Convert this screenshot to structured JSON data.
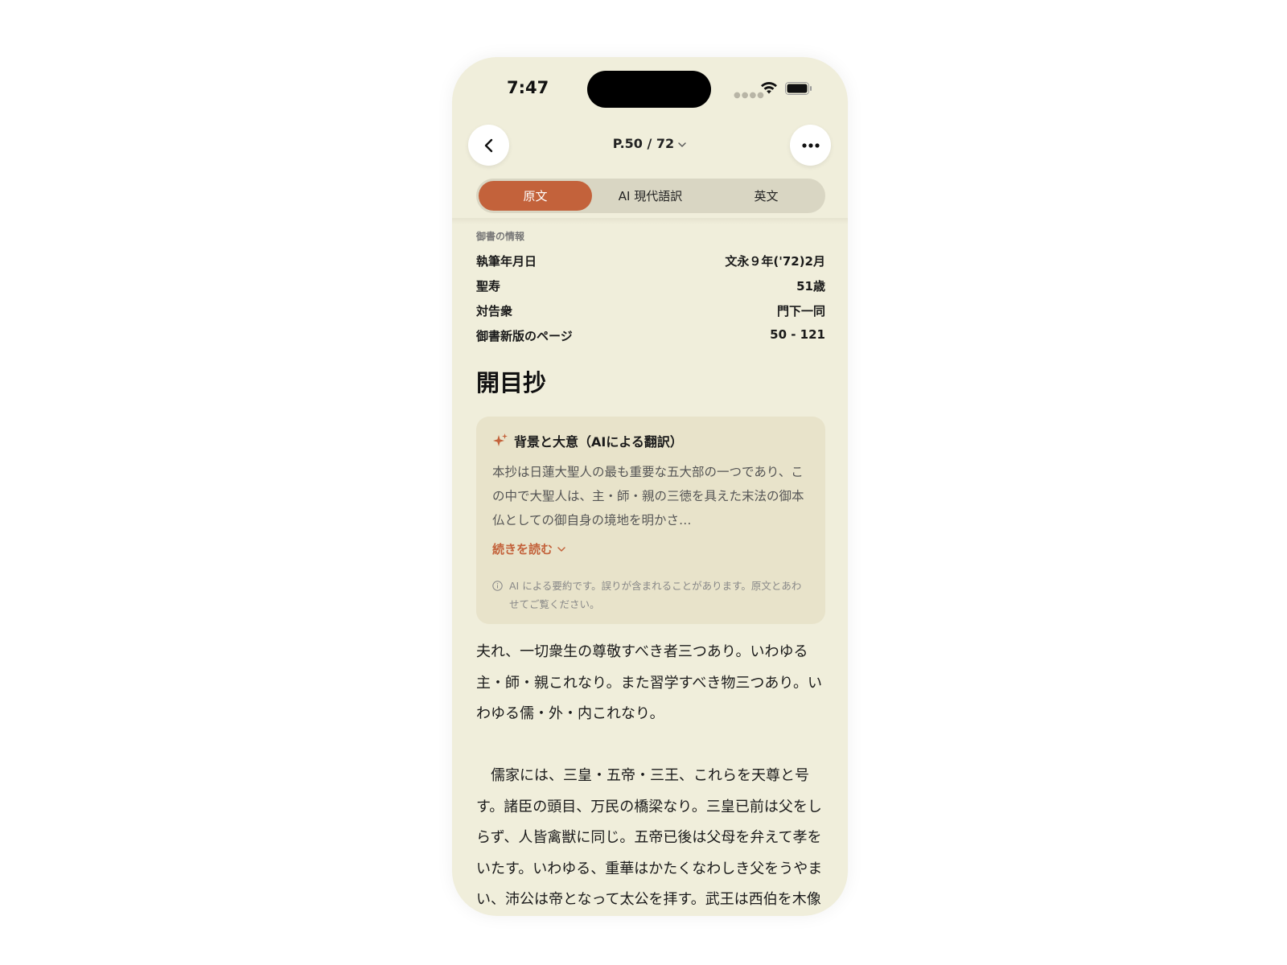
{
  "status_bar": {
    "time": "7:47"
  },
  "header": {
    "page_indicator": "P.50 / 72"
  },
  "tabs": [
    {
      "label": "原文",
      "active": true
    },
    {
      "label": "AI 現代語訳",
      "active": false
    },
    {
      "label": "英文",
      "active": false
    }
  ],
  "info": {
    "caption": "御書の情報",
    "rows": [
      {
        "label": "執筆年月日",
        "value": "文永９年('72)2月"
      },
      {
        "label": "聖寿",
        "value": "51歳"
      },
      {
        "label": "対告衆",
        "value": "門下一同"
      },
      {
        "label": "御書新版のページ",
        "value": "50 - 121"
      }
    ]
  },
  "title": "開目抄",
  "ai_summary": {
    "heading": "背景と大意（AIによる翻訳）",
    "body": "本抄は日蓮大聖人の最も重要な五大部の一つであり、この中で大聖人は、主・師・親の三徳を具えた末法の御本仏としての御自身の境地を明かさ…",
    "read_more": "続きを読む",
    "note": "AI による要約です。誤りが含まれることがあります。原文とあわせてご覧ください。"
  },
  "original_text": {
    "p1": "夫れ、一切衆生の尊敬すべき者三つあり。いわゆる主・師・親これなり。また習学すべき物三つあり。いわゆる儒・外・内これなり。",
    "p2": "　儒家には、三皇・五帝・三王、これらを天尊と号す。諸臣の頭目、万民の橋梁なり。三皇已前は父をしらず、人皆禽獣に同じ。五帝已後は父母を弁えて孝をいたす。いわゆる、重華はかたくなわしき父をうやまい、沛公は帝となって太公を拝す。武王は西伯を木像に造る。丁蘭は母の形をきざめり。"
  },
  "colors": {
    "accent": "#c3623b",
    "background": "#f0eedb",
    "card": "#e8e3ca"
  }
}
